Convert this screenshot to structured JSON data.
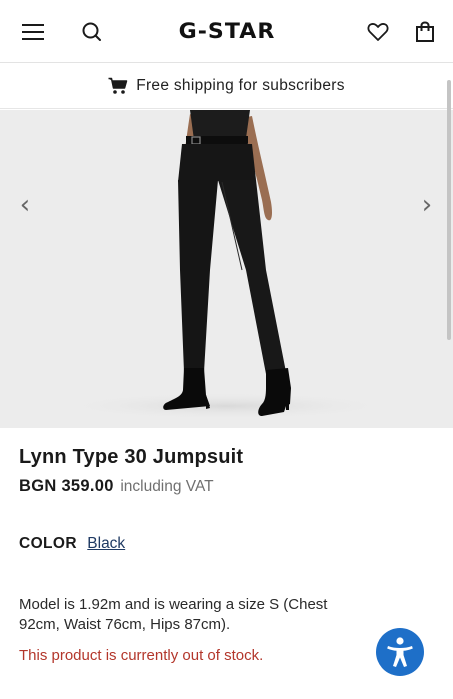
{
  "header": {
    "brand": "G-STAR",
    "icons": [
      "menu-icon",
      "search-icon",
      "heart-icon",
      "shopping-bag-icon"
    ]
  },
  "banner": {
    "text": "Free shipping for subscribers",
    "icon": "cart-icon"
  },
  "gallery": {
    "prev_arrow": "‹",
    "next_arrow": "›"
  },
  "product": {
    "title": "Lynn Type 30 Jumpsuit",
    "price": "BGN 359.00",
    "vat_note": "including VAT",
    "color_label": "COLOR",
    "color_value": "Black",
    "model_info": "Model is 1.92m and is wearing a size S (Chest 92cm, Waist 76cm, Hips 87cm).",
    "stock_status": "This product is currently out of stock."
  },
  "colors": {
    "accent_link": "#1f3a63",
    "out_of_stock": "#b3362b",
    "accessibility_button": "#1e6fc8",
    "gallery_bg": "#ececec"
  }
}
